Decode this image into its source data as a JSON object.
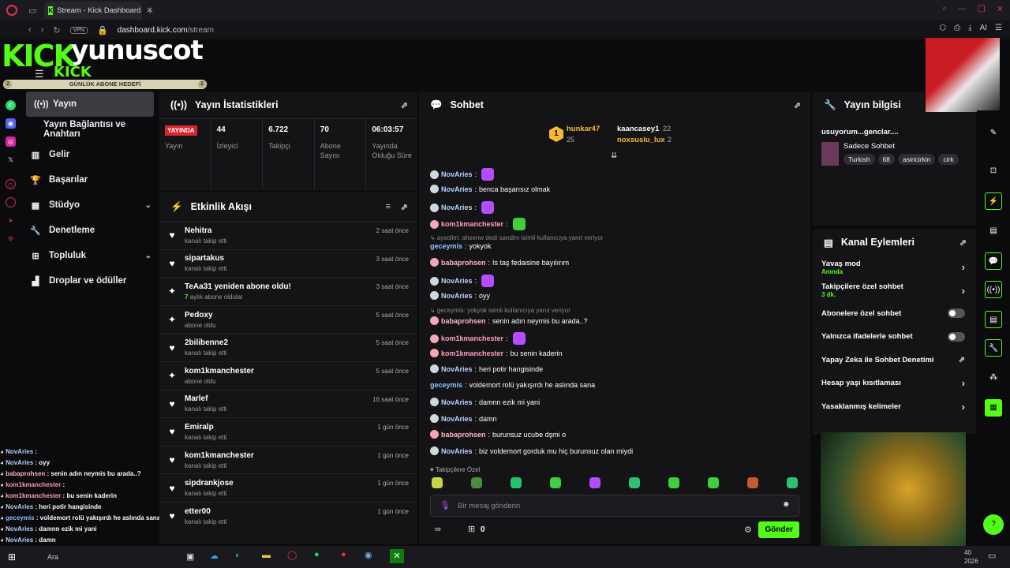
{
  "browser": {
    "tab_title": "Stream - Kick Dashboard",
    "vpn": "VPN",
    "url_domain": "dashboard.kick.com",
    "url_path": "/stream"
  },
  "brand": {
    "kick": "KICK",
    "username": "yunuscot",
    "kick_small": "KICK",
    "goal_label": "GÜNLÜK ABONE HEDEFİ",
    "goal_left": "2",
    "goal_right": "2"
  },
  "nav": [
    {
      "label": "Yayın",
      "icon": "((•))"
    },
    {
      "label": "Yayın Bağlantısı ve Anahtarı"
    },
    {
      "label": "Gelir",
      "icon": "▥"
    },
    {
      "label": "Başarılar",
      "icon": "🏆"
    },
    {
      "label": "Stüdyo",
      "icon": "▦"
    },
    {
      "label": "Denetleme",
      "icon": "🔧"
    },
    {
      "label": "Topluluk",
      "icon": "⊞"
    },
    {
      "label": "Droplar ve ödüller",
      "icon": "▟"
    }
  ],
  "minichat": [
    {
      "user": "NovAries",
      "text": " : ",
      "color": "#b8d4ff"
    },
    {
      "user": "NovAries",
      "text": " : oyy",
      "color": "#b8d4ff"
    },
    {
      "user": "babaprohsen",
      "text": " : senin adın neymis bu arada..?",
      "color": "#ffb3c6"
    },
    {
      "user": "kom1kmanchester",
      "text": " : ",
      "color": "#ff9ec0"
    },
    {
      "user": "kom1kmanchester",
      "text": " : bu senin kaderin",
      "color": "#ff9ec0"
    },
    {
      "user": "NovAries",
      "text": " : heri potir hangisinde",
      "color": "#b8d4ff"
    },
    {
      "user": "geceymis",
      "text": " : voldemort rolü yakışırdı he aslında sana",
      "color": "#8fc3ff"
    },
    {
      "user": "NovAries",
      "text": " : damnn ezik mi yani",
      "color": "#b8d4ff"
    },
    {
      "user": "NovAries",
      "text": " : damn",
      "color": "#b8d4ff"
    }
  ],
  "stats": {
    "title": "Yayın İstatistikleri",
    "badge": "YAYINDA",
    "cols": [
      {
        "value": "",
        "label": "Yayın"
      },
      {
        "value": "44",
        "label": "İzleyici"
      },
      {
        "value": "6.722",
        "label": "Takipçi"
      },
      {
        "value": "70",
        "label": "Abone Sayısı"
      },
      {
        "value": "06:03:57",
        "label": "Yayında Olduğu Süre"
      }
    ]
  },
  "activity": {
    "title": "Etkinlik Akışı",
    "items": [
      {
        "name": "Nehitra",
        "desc": "kanalı takip etti",
        "time": "2 saat önce",
        "icon": "♥"
      },
      {
        "name": "sipartakus",
        "desc": "kanalı takip etti",
        "time": "3 saat önce",
        "icon": "♥"
      },
      {
        "name": "TeAa31 yeniden abone oldu!",
        "desc_hl": "7",
        "desc": " aylık abone oldular",
        "time": "3 saat önce",
        "icon": "✦"
      },
      {
        "name": "Pedoxy",
        "desc": "abone oldu",
        "time": "5 saat önce",
        "icon": "✦"
      },
      {
        "name": "2bilibenne2",
        "desc": "kanalı takip etti",
        "time": "5 saat önce",
        "icon": "♥"
      },
      {
        "name": "kom1kmanchester",
        "desc": "abone oldu",
        "time": "5 saat önce",
        "icon": "✦"
      },
      {
        "name": "Marlef",
        "desc": "kanalı takip etti",
        "time": "16 saat önce",
        "icon": "♥"
      },
      {
        "name": "Emiralp",
        "desc": "kanalı takip etti",
        "time": "1 gün önce",
        "icon": "♥"
      },
      {
        "name": "kom1kmanchester",
        "desc": "kanalı takip etti",
        "time": "1 gün önce",
        "icon": "♥"
      },
      {
        "name": "sipdrankjose",
        "desc": "kanalı takip etti",
        "time": "1 gün önce",
        "icon": "♥"
      },
      {
        "name": "etter00",
        "desc": "kanalı takip etti",
        "time": "1 gün önce",
        "icon": "♥"
      }
    ]
  },
  "chat": {
    "title": "Sohbet",
    "pinned": [
      {
        "rank": "1",
        "name": "hunkar47",
        "count": "25"
      },
      {
        "name": "kaancasey1",
        "count": "22"
      },
      {
        "name": "noxsuslu_lux",
        "count": "2"
      }
    ],
    "messages": [
      {
        "type": "msg",
        "user": "NovAries",
        "text": "",
        "emote": "#b44dff",
        "color": "#b8d4ff",
        "bear": "#cfd8dc"
      },
      {
        "type": "msg",
        "user": "NovAries",
        "text": " benca başarısız olmak",
        "color": "#b8d4ff",
        "bear": "#cfd8dc"
      },
      {
        "type": "msg",
        "user": "NovAries",
        "text": "",
        "emote": "#b44dff",
        "color": "#b8d4ff",
        "bear": "#cfd8dc"
      },
      {
        "type": "msg",
        "user": "kom1kmanchester",
        "text": "",
        "emote": "#3ecf3e",
        "color": "#ff9ec0",
        "bear": "#f4a7b9"
      },
      {
        "type": "reply",
        "text": "↳ aysolim: ahsenw dedi sandim isimli kullanıcıya yanıt veriyor"
      },
      {
        "type": "msg",
        "user": "geceymis",
        "text": " yokyok",
        "color": "#8fc3ff"
      },
      {
        "type": "msg",
        "user": "babaprohsen",
        "text": " Is taş fedaisine bayılırım",
        "color": "#ffb3c6",
        "bear": "#f4a7b9"
      },
      {
        "type": "msg",
        "user": "NovAries",
        "text": "",
        "emote": "#b44dff",
        "color": "#b8d4ff",
        "bear": "#cfd8dc"
      },
      {
        "type": "msg",
        "user": "NovAries",
        "text": " oyy",
        "color": "#b8d4ff",
        "bear": "#cfd8dc"
      },
      {
        "type": "reply",
        "text": "↳ geceymis: yokyok isimli kullanıcıya yanıt veriyor"
      },
      {
        "type": "msg",
        "user": "babaprohsen",
        "text": " senin adın neymis bu arada..?",
        "color": "#ffb3c6",
        "bear": "#f4a7b9"
      },
      {
        "type": "msg",
        "user": "kom1kmanchester",
        "text": "",
        "emote": "#b44dff",
        "color": "#ff9ec0",
        "bear": "#f4a7b9"
      },
      {
        "type": "msg",
        "user": "kom1kmanchester",
        "text": " bu senin kaderin",
        "color": "#ff9ec0",
        "bear": "#f4a7b9"
      },
      {
        "type": "msg",
        "user": "NovAries",
        "text": " heri potir hangisinde",
        "color": "#b8d4ff",
        "bear": "#cfd8dc"
      },
      {
        "type": "msg",
        "user": "geceymis",
        "text": " voldemort rolü yakışırdı he aslında sana",
        "color": "#8fc3ff"
      },
      {
        "type": "msg",
        "user": "NovAries",
        "text": " damnn ezik mi yani",
        "color": "#b8d4ff",
        "bear": "#cfd8dc"
      },
      {
        "type": "msg",
        "user": "NovAries",
        "text": " damn",
        "color": "#b8d4ff",
        "bear": "#cfd8dc"
      },
      {
        "type": "msg",
        "user": "babaprohsen",
        "text": " burunsuz ucube dşmi o",
        "color": "#ffb3c6",
        "bear": "#f4a7b9"
      },
      {
        "type": "msg",
        "user": "NovAries",
        "text": " biz voldemort gorduk mu hiç burunsuz olan miydi",
        "color": "#b8d4ff",
        "bear": "#cfd8dc"
      }
    ],
    "followers_only": "♥ Takipçilere Özel",
    "placeholder": "Bir mesaj gönderin",
    "count": "0",
    "send": "Gönder"
  },
  "info": {
    "title": "Yayın bilgisi",
    "stream_title": "usuyorum...genclar....",
    "category": "Sadece Sohbet",
    "tags": [
      "Turkish",
      "68",
      "asiricirkin",
      "cirk"
    ]
  },
  "actions": {
    "title": "Kanal Eylemleri",
    "items": [
      {
        "label": "Yavaş mod",
        "sub": "Anında",
        "ctrl": "chevron"
      },
      {
        "label": "Takipçilere özel sohbet",
        "sub": "3 dk.",
        "ctrl": "chevron"
      },
      {
        "label": "Abonelere özel sohbet",
        "ctrl": "toggle"
      },
      {
        "label": "Yalnızca ifadelerle sohbet",
        "ctrl": "toggle"
      },
      {
        "label": "Yapay Zeka ile Sohbet Denetimi",
        "ctrl": "ext"
      },
      {
        "label": "Hesap yaşı kısıtlaması",
        "ctrl": "chevron"
      },
      {
        "label": "Yasaklanmış kelimeler",
        "ctrl": "chevron"
      }
    ]
  },
  "taskbar": {
    "search": "Ara",
    "clock": "40",
    "year": "2026"
  },
  "colors": {
    "kick_green": "#53fc18",
    "live_red": "#d9262e"
  }
}
